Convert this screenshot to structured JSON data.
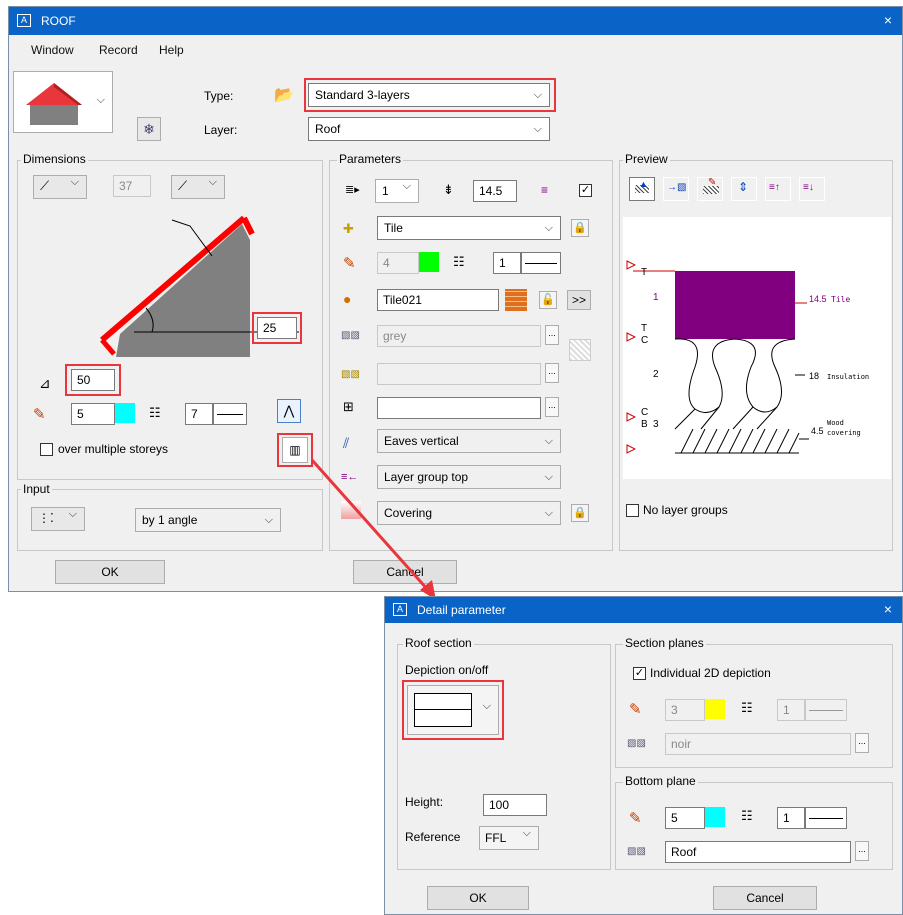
{
  "main": {
    "title": "ROOF",
    "close": "×",
    "menu": [
      "Window",
      "Record",
      "Help"
    ],
    "type_label": "Type:",
    "type_value": "Standard 3-layers",
    "layer_label": "Layer:",
    "layer_value": "Roof",
    "dimensions": {
      "label": "Dimensions",
      "value_top": "37",
      "value_angle": "25",
      "value_thickness": "50",
      "pen": "5",
      "line": "7",
      "over_storeys": "over multiple storeys"
    },
    "input": {
      "label": "Input",
      "mode": "by 1 angle"
    },
    "parameters": {
      "label": "Parameters",
      "layers": "1",
      "thickness": "14.5",
      "material": "Tile",
      "pen": "4",
      "line": "1",
      "surface": "Tile021",
      "hatch_name": "grey",
      "pattern": "",
      "fill": "",
      "eaves": "Eaves vertical",
      "group": "Layer group top",
      "covering": "Covering",
      "more": ">>",
      "dots": "..."
    },
    "preview": {
      "label": "Preview",
      "no_groups": "No layer groups",
      "labels": {
        "t1": "T",
        "t2": "T",
        "c1": "C",
        "c2": "C",
        "b": "B",
        "n1": "1",
        "n2": "2",
        "n3": "3",
        "v1": "14.5",
        "v1b": "Tile",
        "v2": "18",
        "v2b": "Insulation",
        "v3": "4.5",
        "v3a": "Wood",
        "v3b": "covering"
      }
    },
    "ok": "OK",
    "cancel": "Cancel",
    "colors": {
      "pen5": "#00ffff",
      "pen4": "#00ff00",
      "preview_layer": "#800080",
      "highlight": "#e8363c"
    }
  },
  "detail": {
    "title": "Detail parameter",
    "close": "×",
    "roof_section": "Roof section",
    "depiction": "Depiction on/off",
    "height_label": "Height:",
    "height_value": "100",
    "reference_label": "Reference",
    "reference_value": "FFL",
    "section_planes": "Section planes",
    "individual": "Individual 2D depiction",
    "sp_pen": "3",
    "sp_line": "1",
    "sp_hatch": "noir",
    "bottom_plane": "Bottom plane",
    "bp_pen": "5",
    "bp_line": "1",
    "bp_hatch": "Roof",
    "ok": "OK",
    "cancel": "Cancel",
    "dots": "...",
    "colors": {
      "pen3": "#ffff00",
      "pen5": "#00ffff"
    }
  }
}
